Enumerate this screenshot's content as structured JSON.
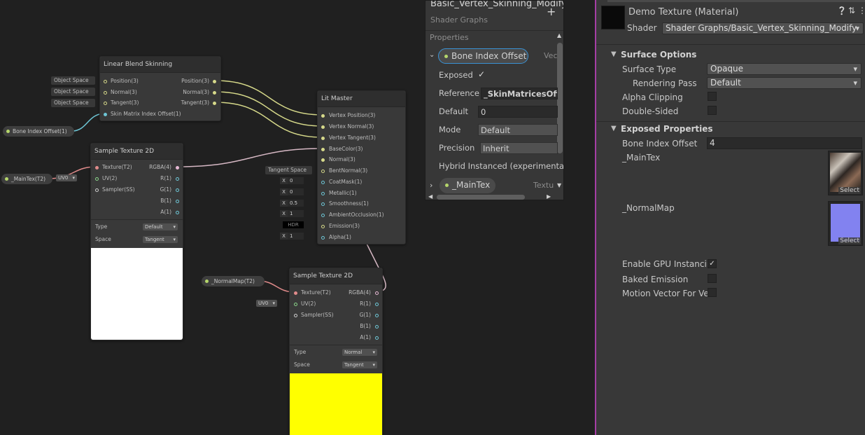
{
  "graph": {
    "linear_blend_node": {
      "title": "Linear Blend Skinning",
      "inputs": [
        "Position(3)",
        "Normal(3)",
        "Tangent(3)",
        "Skin Matrix Index Offset(1)"
      ],
      "outputs": [
        "Position(3)",
        "Normal(3)",
        "Tangent(3)"
      ],
      "space_pills": [
        "Object Space",
        "Object Space",
        "Object Space"
      ]
    },
    "bone_index_node": {
      "label": "Bone Index Offset(1)"
    },
    "maintex_node": {
      "label": "_MainTex(T2)",
      "uv": "UV0"
    },
    "normalmap_node": {
      "label": "_NormalMap(T2)",
      "uv": "UV0"
    },
    "sample_texture_1": {
      "title": "Sample Texture 2D",
      "inputs": [
        "Texture(T2)",
        "UV(2)",
        "Sampler(SS)"
      ],
      "outputs": [
        "RGBA(4)",
        "R(1)",
        "G(1)",
        "B(1)",
        "A(1)"
      ],
      "type_label": "Type",
      "type_value": "Default",
      "space_label": "Space",
      "space_value": "Tangent",
      "preview_color": "#ffffff"
    },
    "sample_texture_2": {
      "title": "Sample Texture 2D",
      "inputs": [
        "Texture(T2)",
        "UV(2)",
        "Sampler(SS)"
      ],
      "outputs": [
        "RGBA(4)",
        "R(1)",
        "G(1)",
        "B(1)",
        "A(1)"
      ],
      "type_label": "Type",
      "type_value": "Normal",
      "space_label": "Space",
      "space_value": "Tangent",
      "preview_color": "#ffff00"
    },
    "lit_master": {
      "title": "Lit Master",
      "inputs": [
        "Vertex Position(3)",
        "Vertex Normal(3)",
        "Vertex Tangent(3)",
        "BaseColor(3)",
        "Normal(3)",
        "BentNormal(3)",
        "CoatMask(1)",
        "Metallic(1)",
        "Smoothness(1)",
        "AmbientOcclusion(1)",
        "Emission(3)",
        "Alpha(1)"
      ],
      "tangent_space_pill": "Tangent Space",
      "slots": [
        {
          "axis": "X",
          "value": "0"
        },
        {
          "axis": "X",
          "value": "0"
        },
        {
          "axis": "X",
          "value": "0.5"
        },
        {
          "axis": "X",
          "value": "1"
        },
        {
          "axis": "",
          "value": "HDR"
        },
        {
          "axis": "X",
          "value": "1"
        }
      ]
    }
  },
  "blackboard": {
    "title": "Basic_Vertex_Skinning_Modify",
    "subtitle": "Shader Graphs",
    "add_label": "+",
    "section": "Properties",
    "prop1": {
      "name": "Bone Index Offset",
      "type_trunc": "Vec"
    },
    "fields": {
      "exposed_label": "Exposed",
      "exposed_check": "✓",
      "reference_label": "Reference",
      "reference_value": "_SkinMatricesOff",
      "default_label": "Default",
      "default_value": "0",
      "mode_label": "Mode",
      "mode_value": "Default",
      "precision_label": "Precision",
      "precision_value": "Inherit",
      "hybrid_label": "Hybrid Instanced (experimental)"
    },
    "prop2": {
      "name": "_MainTex",
      "type_trunc": "Textu"
    }
  },
  "inspector": {
    "material_name": "Demo Texture (Material)",
    "shader_label": "Shader",
    "shader_value": "Shader Graphs/Basic_Vertex_Skinning_Modify",
    "surface_options": "Surface Options",
    "surface_type_label": "Surface Type",
    "surface_type_value": "Opaque",
    "rendering_pass_label": "Rendering Pass",
    "rendering_pass_value": "Default",
    "alpha_clipping_label": "Alpha Clipping",
    "double_sided_label": "Double-Sided",
    "exposed_properties": "Exposed Properties",
    "bone_index_label": "Bone Index Offset",
    "bone_index_value": "4",
    "maintex_label": "_MainTex",
    "normalmap_label": "_NormalMap",
    "select_label": "Select",
    "gpu_instancing_label": "Enable GPU Instancin",
    "gpu_instancing_check": "✓",
    "baked_emission_label": "Baked Emission",
    "motion_vector_label": "Motion Vector For Ve",
    "colors": {
      "accent_border": "#a53ea5",
      "normalmap_tint": "#8080ff"
    }
  }
}
